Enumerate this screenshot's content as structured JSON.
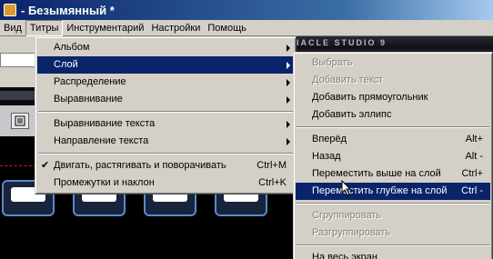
{
  "window": {
    "title": "- Безымянный *"
  },
  "menubar": {
    "items": [
      "Вид",
      "Титры",
      "Инструментарий",
      "Настройки",
      "Помощь"
    ]
  },
  "banner": {
    "text": "IACLE STUDIO 9"
  },
  "titles_menu": {
    "items": [
      {
        "label": "Альбом",
        "arrow": true
      },
      {
        "label": "Слой",
        "arrow": true,
        "highlight": true
      },
      {
        "label": "Распределение",
        "arrow": true
      },
      {
        "label": "Выравнивание",
        "arrow": true
      },
      {
        "separator": true
      },
      {
        "label": "Выравнивание текста",
        "arrow": true
      },
      {
        "label": "Направление текста",
        "arrow": true
      },
      {
        "separator": true
      },
      {
        "label": "Двигать, растягивать и поворачивать",
        "shortcut": "Ctrl+M",
        "checked": true
      },
      {
        "label": "Промежутки и наклон",
        "shortcut": "Ctrl+K"
      }
    ]
  },
  "layer_menu": {
    "items": [
      {
        "label": "Выбрать",
        "disabled": true
      },
      {
        "label": "Добавить текст",
        "disabled": true
      },
      {
        "label": "Добавить прямоугольник"
      },
      {
        "label": "Добавить эллипс"
      },
      {
        "separator": true
      },
      {
        "label": "Вперёд",
        "shortcut": "Alt+"
      },
      {
        "label": "Назад",
        "shortcut": "Alt -"
      },
      {
        "label": "Переместить выше на слой",
        "shortcut": "Ctrl+"
      },
      {
        "label": "Переместить глубже на слой",
        "shortcut": "Ctrl -",
        "highlight": true
      },
      {
        "separator": true
      },
      {
        "label": "Сгруппировать",
        "disabled": true
      },
      {
        "label": "Разгруппировать",
        "disabled": true
      },
      {
        "separator": true
      },
      {
        "label": "На весь экран"
      }
    ]
  },
  "colors": {
    "selection": "#0a246a",
    "menu_bg": "#d4d0c8"
  }
}
